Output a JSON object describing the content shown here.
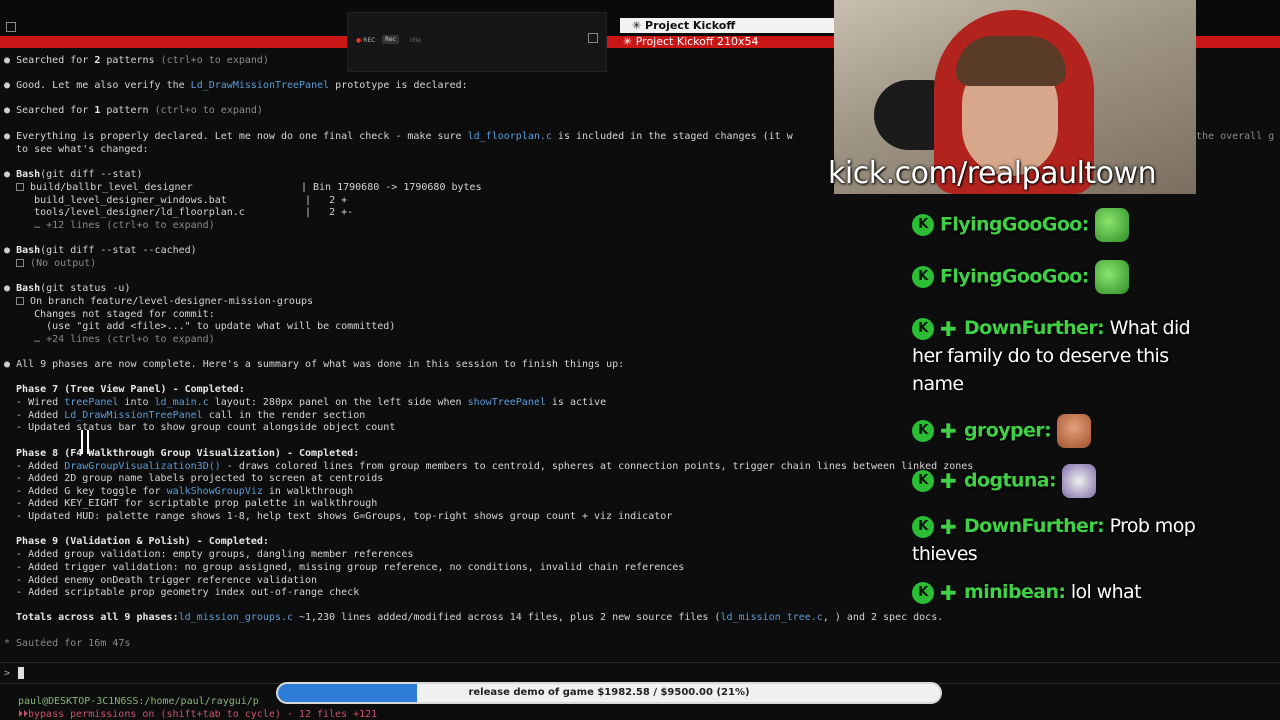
{
  "window": {
    "tab_title": "Project Kickoff",
    "tab_subtitle": "Project Kickoff 210x54"
  },
  "recorder": {
    "rec": "REC",
    "rec_button": "Rec",
    "idle": "Idle"
  },
  "terminal": {
    "lines": [
      {
        "dot": "●",
        "text": "Searched for ",
        "b": "2",
        "t2": " patterns",
        "dim": " (ctrl+o to expand)"
      },
      {
        "dot": "●",
        "text": "Good. Let me also verify the ",
        "blue": "Ld_DrawMissionTreePanel",
        "t2": " prototype is declared:"
      },
      {
        "dot": "●",
        "text": "Searched for ",
        "b": "1",
        "t2": " pattern",
        "dim": " (ctrl+o to expand)"
      },
      {
        "dot": "●",
        "text": "Everything is properly declared. Let me now do one final check - make sure ",
        "blue": "ld_floorplan.c",
        "t2": " is included in the staged changes (it w"
      },
      {
        "text": "  to see what's changed:"
      },
      {
        "dot": "●",
        "b": "Bash",
        "t2": "(git diff --stat)"
      },
      {
        "icon": true,
        "text": "build/ballbr_level_designer                  | Bin 1790680 -> 1790680 bytes"
      },
      {
        "text": "     build_level_designer_windows.bat             |   2 +"
      },
      {
        "text": "     tools/level_designer/ld_floorplan.c          |   2 +-"
      },
      {
        "dim": "     … +12 lines (ctrl+o to expand)"
      },
      {
        "dot": "●",
        "b": "Bash",
        "t2": "(git diff --stat --cached)"
      },
      {
        "icon": true,
        "dim": "(No output)"
      },
      {
        "dot": "●",
        "b": "Bash",
        "t2": "(git status -u)"
      },
      {
        "icon": true,
        "text": "On branch feature/level-designer-mission-groups"
      },
      {
        "text": "     Changes not staged for commit:"
      },
      {
        "text": "       (use \"git add <file>...\" to update what will be committed)"
      },
      {
        "dim": "     … +24 lines (ctrl+o to expand)"
      },
      {
        "dot": "●",
        "text": "All 9 phases are now complete. Here's a summary of what was done in this session to finish things up:"
      },
      {
        "b": "  Phase 7 (Tree View Panel) - Completed:"
      },
      {
        "text": "  - Wired ",
        "blue": "treePanel",
        "t2": " into ",
        "blue2": "ld_main.c",
        "t3": " layout: 280px panel on the left side when ",
        "blue3": "showTreePanel",
        "t4": " is active"
      },
      {
        "text": "  - Added ",
        "blue": "Ld_DrawMissionTreePanel",
        "t2": " call in the render section"
      },
      {
        "text": "  - Updated status bar to show group count alongside object count"
      },
      {
        "b": "  Phase 8 (F4 Walkthrough Group Visualization) - Completed:"
      },
      {
        "text": "  - Added ",
        "blue": "DrawGroupVisualization3D()",
        "t2": " - draws colored lines from group members to centroid, spheres at connection points, trigger chain lines between linked zones"
      },
      {
        "text": "  - Added 2D group name labels projected to screen at centroids"
      },
      {
        "text": "  - Added G key toggle for ",
        "blue": "walkShowGroupViz",
        "t2": " in walkthrough"
      },
      {
        "text": "  - Added KEY_EIGHT for scriptable prop palette in walkthrough"
      },
      {
        "text": "  - Updated HUD: palette range shows 1-8, help text shows G=Groups, top-right shows group count + viz indicator"
      },
      {
        "b": "  Phase 9 (Validation & Polish) - Completed:"
      },
      {
        "text": "  - Added group validation: empty groups, dangling member references"
      },
      {
        "text": "  - Added trigger validation: no group assigned, missing group reference, no conditions, invalid chain references"
      },
      {
        "text": "  - Added enemy onDeath trigger reference validation"
      },
      {
        "text": "  - Added scriptable prop geometry index out-of-range check"
      },
      {
        "b": "  Totals across all 9 phases:",
        "t2": " ~1,230 lines added/modified across 14 files, plus 2 new source files (",
        "blue": "ld_mission_groups.c",
        "t3": ", ",
        "blue2": "ld_mission_tree.c",
        "t4": ") and 2 spec docs."
      },
      {
        "dim": "* Sautéed for 16m 47s"
      }
    ],
    "right_fragment": "the overall g",
    "prompt_char": ">",
    "status_path": "paul@DESKTOP-3C1N6SS:/home/paul/raygui/p",
    "status_perm": "⏵⏵bypass permissions on (shift+tab to cycle) · 12 files +121"
  },
  "stream": {
    "kick_url": "kick.com/realpaultown",
    "chat": [
      {
        "user": "FlyingGooGoo:",
        "text": "",
        "emote": "green",
        "sub": false
      },
      {
        "user": "FlyingGooGoo:",
        "text": "",
        "emote": "green",
        "sub": false
      },
      {
        "user": "DownFurther:",
        "text": "What did her family do to deserve this name",
        "sub": true
      },
      {
        "user": "groyper:",
        "text": "",
        "emote": "face",
        "sub": true
      },
      {
        "user": "dogtuna:",
        "text": "",
        "emote": "bird",
        "sub": true
      },
      {
        "user": "DownFurther:",
        "text": "Prob mop thieves",
        "sub": true
      },
      {
        "user": "minibean:",
        "text": "lol what",
        "sub": true
      }
    ],
    "goal": {
      "label": "release demo of game $1982.58 / $9500.00 (21%)",
      "fraction": 0.21
    }
  }
}
